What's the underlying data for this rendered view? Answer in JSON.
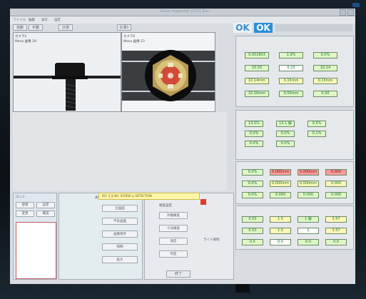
{
  "window": {
    "title": "Vision Inspection  [GT5]  Run"
  },
  "menu": {
    "file": "ファイル",
    "edit": "編集",
    "view": "表示",
    "settings": "設定"
  },
  "camera1": {
    "label": "カメラ1",
    "info": "Mono 画像 29"
  },
  "camera2": {
    "label": "カメラ2",
    "info": "Mono 画像 23"
  },
  "toolbar": {
    "b1": "自動",
    "b2": "手動",
    "b3": "計測",
    "b4": "計測1"
  },
  "ok1": "OK",
  "ok2": "OK",
  "status_bar": "ID1  寸法 NO.  SCREW  ◎  DETECTION",
  "right_top_tabs": [
    "外観検査",
    "寸法検査",
    "外径"
  ],
  "right_top_values": [
    {
      "v": "0.001803",
      "c": "g"
    },
    {
      "v": "1.9%",
      "c": "g"
    },
    {
      "v": "0.0%",
      "c": "g"
    },
    {
      "v": "10.55",
      "c": "g"
    },
    {
      "v": "0.23",
      "c": "w"
    },
    {
      "v": "10.14",
      "c": "g"
    },
    {
      "v": "10.14mm",
      "c": "y"
    },
    {
      "v": "0.15mm",
      "c": "y"
    },
    {
      "v": "0.15mm",
      "c": "y"
    },
    {
      "v": "10.00mm",
      "c": "g"
    },
    {
      "v": "0.00mm",
      "c": "g"
    },
    {
      "v": "0.00",
      "c": "g"
    }
  ],
  "mid_header": [
    "検出項目",
    "判定",
    "数値"
  ],
  "mid_values": [
    {
      "v": "13.5%",
      "c": "g"
    },
    {
      "v": "13.1 解",
      "c": "g"
    },
    {
      "v": "0.5%",
      "c": "g"
    },
    {
      "v": "0.0%",
      "c": "g"
    },
    {
      "v": "0.0%",
      "c": "g"
    },
    {
      "v": "0.1%",
      "c": "g"
    },
    {
      "v": "0.0%",
      "c": "g"
    },
    {
      "v": "0.0%",
      "c": "g"
    }
  ],
  "lower_right_values": [
    {
      "v": "0.0%",
      "c": "g"
    },
    {
      "v": "0.000mm",
      "c": "r"
    },
    {
      "v": "0.000mm",
      "c": "r"
    },
    {
      "v": "0.000",
      "c": "r"
    },
    {
      "v": "0.0%",
      "c": "g"
    },
    {
      "v": "0.000mm",
      "c": "y"
    },
    {
      "v": "0.000mm",
      "c": "y"
    },
    {
      "v": "0.000",
      "c": "y"
    },
    {
      "v": "0.0%",
      "c": "g"
    },
    {
      "v": "0.000",
      "c": "g"
    },
    {
      "v": "0.000",
      "c": "g"
    },
    {
      "v": "0.000",
      "c": "g"
    }
  ],
  "bottom_right_values": [
    {
      "v": "0.53",
      "c": "g"
    },
    {
      "v": "1.5",
      "c": "y"
    },
    {
      "v": "1 解",
      "c": "g"
    },
    {
      "v": "3.57",
      "c": "y"
    },
    {
      "v": "0.53",
      "c": "g"
    },
    {
      "v": "1.5",
      "c": "y"
    },
    {
      "v": "1",
      "c": "w"
    },
    {
      "v": "3.57",
      "c": "y"
    },
    {
      "v": "0.5",
      "c": "g"
    },
    {
      "v": "0.0",
      "c": "w"
    },
    {
      "v": "0.0",
      "c": "g"
    },
    {
      "v": "0.0",
      "c": "g"
    }
  ],
  "left_panel": {
    "title": "ロット",
    "buttons": [
      "登録",
      "設定",
      "変更",
      "確認"
    ]
  },
  "inspect_panel": {
    "title": "表示設定",
    "items": [
      "全画面",
      "不良画面",
      "画像保存",
      "照明",
      "拡大"
    ]
  },
  "judge_panel": {
    "title": "検査設定",
    "items": [
      "外観検査",
      "寸法検査",
      "測定",
      "判定"
    ]
  },
  "end_button": "終了",
  "right_msg": "ライト接続"
}
